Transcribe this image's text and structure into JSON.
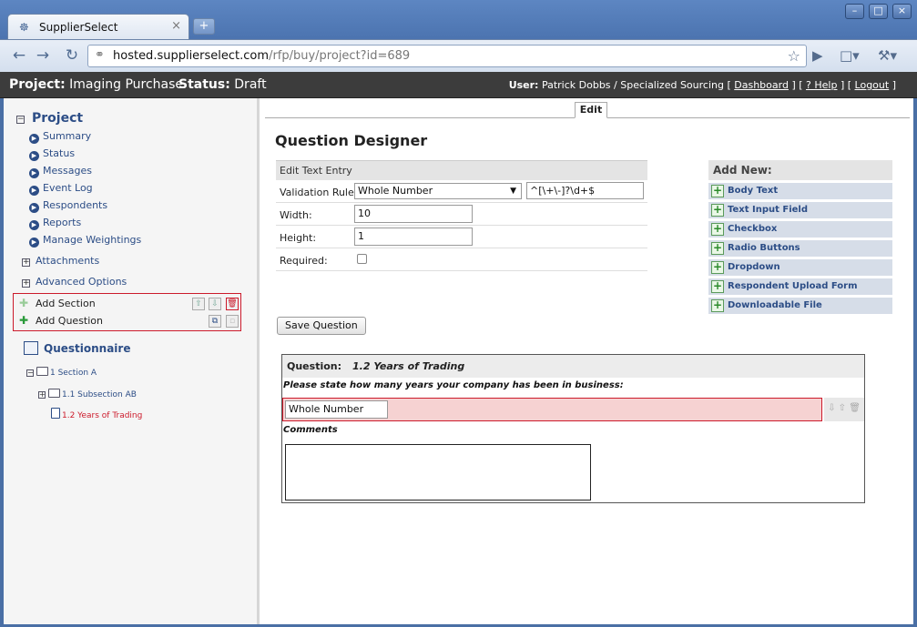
{
  "browser": {
    "tab_title": "SupplierSelect",
    "url_host": "hosted.supplierselect.com",
    "url_path": "/rfp/buy/project?id=689"
  },
  "header": {
    "project_label": "Project:",
    "project_name": "Imaging Purchase",
    "status_label": "Status:",
    "status_value": "Draft",
    "user_label": "User:",
    "user_name": "Patrick Dobbs / Specialized Sourcing",
    "links": [
      "Dashboard",
      "? Help",
      "Logout"
    ]
  },
  "sidebar": {
    "title": "Project",
    "items": [
      "Summary",
      "Status",
      "Messages",
      "Event Log",
      "Respondents",
      "Reports",
      "Manage Weightings"
    ],
    "expandable": [
      "Attachments",
      "Advanced Options"
    ],
    "add_section": "Add Section",
    "add_question": "Add Question",
    "questionnaire": "Questionnaire",
    "tree": {
      "section": "1 Section A",
      "subsection": "1.1 Subsection AB",
      "question": "1.2 Years of Trading"
    }
  },
  "main": {
    "tab": "Edit",
    "title": "Question Designer",
    "form": {
      "header": "Edit Text Entry",
      "validation_label": "Validation Rule",
      "validation_value": "Whole Number",
      "regex": "^[\\+\\-]?\\d+$",
      "width_label": "Width:",
      "width_value": "10",
      "height_label": "Height:",
      "height_value": "1",
      "required_label": "Required:",
      "required": false
    },
    "save_button": "Save Question",
    "add_new": {
      "header": "Add New:",
      "items": [
        "Body Text",
        "Text Input Field",
        "Checkbox",
        "Radio Buttons",
        "Dropdown",
        "Respondent Upload Form",
        "Downloadable File"
      ]
    },
    "preview": {
      "label": "Question:",
      "title": "1.2 Years of Trading",
      "prompt": "Please state how many years your company has been in business:",
      "field_value": "Whole Number",
      "comments_label": "Comments"
    }
  },
  "colors": {
    "accent": "#2c4d86",
    "highlight": "#cc1a2b",
    "header_bg": "#3c3c3c"
  }
}
